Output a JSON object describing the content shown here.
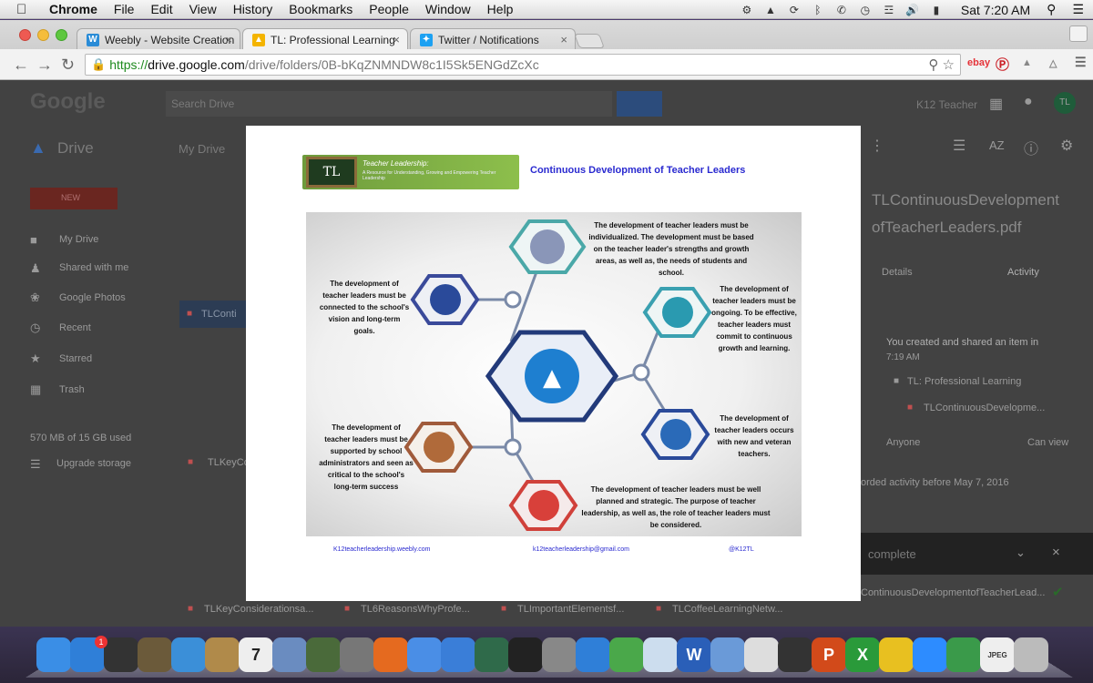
{
  "menubar": {
    "app": "Chrome",
    "items": [
      "File",
      "Edit",
      "View",
      "History",
      "Bookmarks",
      "People",
      "Window",
      "Help"
    ],
    "clock": "Sat 7:20 AM",
    "user": "Q"
  },
  "tabs": [
    {
      "label": "Weebly - Website Creation",
      "icon": "weebly-icon",
      "color": "#2a8cd7"
    },
    {
      "label": "TL: Professional Learning",
      "icon": "google-drive-icon",
      "color": "#f4b400"
    },
    {
      "label": "Twitter / Notifications",
      "icon": "twitter-icon",
      "color": "#1da1f2"
    }
  ],
  "address": {
    "https": "https://",
    "host": "drive.google.com",
    "path": "/drive/folders/0B-bKqZNMNDW8c1I5Sk5ENGdZcXc"
  },
  "drive": {
    "search_placeholder": "Search Drive",
    "app_name": "Drive",
    "breadcrumb": "My Drive",
    "user_name": "K12 Teacher",
    "new_label": "NEW",
    "sidebar": [
      "My Drive",
      "Shared with me",
      "Google Photos",
      "Recent",
      "Starred",
      "Trash"
    ],
    "storage": "570 MB of 15 GB used",
    "upgrade": "Upgrade storage",
    "selected_file_short": "TLConti",
    "file_short": "TLKeyCo",
    "bottom_files": [
      "TLKeyConsiderationsa...",
      "TL6ReasonsWhyProfe...",
      "TLImportantElementsf...",
      "TLCoffeeLearningNetw..."
    ],
    "details_file_name_1": "TLContinuousDevelopment",
    "details_file_name_2": "ofTeacherLeaders.pdf",
    "details_tab": "Details",
    "activity_tab": "Activity",
    "activity_text": "You created and shared an item in",
    "activity_time": "7:19 AM",
    "activity_folder": "TL: Professional Learning",
    "activity_file": "TLContinuousDevelopme...",
    "anyone": "Anyone",
    "can_view": "Can view",
    "no_recorded": "orded activity before May 7, 2016",
    "upload_complete": "complete",
    "upload_file": "ContinuousDevelopmentofTeacherLead..."
  },
  "document": {
    "banner_title": "Teacher Leadership:",
    "banner_sub": "A Resource for Understanding, Growing and Empowering Teacher Leadership",
    "logo_text": "TL",
    "title": "Continuous Development of Teacher Leaders",
    "captions": {
      "top": "The development of teacher leaders must be individualized. The development must be based on the teacher leader's strengths and growth areas, as well as, the needs of students and school.",
      "left_top": "The development of teacher leaders must be connected to the school's vision and long-term goals.",
      "right_top": "The development of teacher leaders must be ongoing. To be effective, teacher leaders must commit to continuous growth and learning.",
      "right_bottom": "The development of teacher leaders occurs with new and veteran teachers.",
      "left_bottom": "The development of teacher leaders must be supported by school administrators and seen as critical to the school's long-term success",
      "bottom": "The development of teacher leaders must be well planned and strategic. The purpose of teacher leadership, as well as, the role of teacher leaders must be considered."
    },
    "footer": [
      "K12teacherleadership.weebly.com",
      "k12teacherleadership@gmail.com",
      "@K12TL"
    ]
  },
  "dock": [
    {
      "name": "finder-icon",
      "color": "#3a8ee6"
    },
    {
      "name": "app-store-icon",
      "color": "#2f7fd8"
    },
    {
      "name": "dashboard-icon",
      "color": "#333333"
    },
    {
      "name": "eagle-icon",
      "color": "#6b5a3a"
    },
    {
      "name": "safari-icon",
      "color": "#3b8fd8"
    },
    {
      "name": "contacts-icon",
      "color": "#b08a4a"
    },
    {
      "name": "calendar-icon",
      "color": "#eeeeee"
    },
    {
      "name": "photo-icon",
      "color": "#6a8cc0"
    },
    {
      "name": "iphoto-icon",
      "color": "#4a6a3a"
    },
    {
      "name": "camera-icon",
      "color": "#777777"
    },
    {
      "name": "firefox-icon",
      "color": "#e56a1f"
    },
    {
      "name": "chrome-icon",
      "color": "#4a8ee6"
    },
    {
      "name": "itunes-icon",
      "color": "#3a7ed8"
    },
    {
      "name": "time-machine-icon",
      "color": "#2f6a4a"
    },
    {
      "name": "imovie-icon",
      "color": "#222222"
    },
    {
      "name": "system-prefs-icon",
      "color": "#888888"
    },
    {
      "name": "weebly-icon",
      "color": "#2f7fd8"
    },
    {
      "name": "network-icon",
      "color": "#4aa84a"
    },
    {
      "name": "sheet-icon",
      "color": "#ccddee"
    },
    {
      "name": "word-icon",
      "color": "#2a5fb8"
    },
    {
      "name": "preview-icon",
      "color": "#6a9ad8"
    },
    {
      "name": "bulb-icon",
      "color": "#dddddd"
    },
    {
      "name": "video-icon",
      "color": "#333333"
    },
    {
      "name": "powerpoint-icon",
      "color": "#d24a1a"
    },
    {
      "name": "excel-icon",
      "color": "#2a9a3a"
    },
    {
      "name": "ring-icon",
      "color": "#e8c020"
    },
    {
      "name": "zoom-icon",
      "color": "#2d8cff"
    },
    {
      "name": "globe-icon",
      "color": "#3a9a4a"
    },
    {
      "name": "jpeg-file-icon",
      "color": "#eeeeee"
    },
    {
      "name": "trash-icon",
      "color": "#bbbbbb"
    }
  ],
  "dock_badge": "1",
  "calendar_day": "7",
  "jpeg_label": "JPEG"
}
